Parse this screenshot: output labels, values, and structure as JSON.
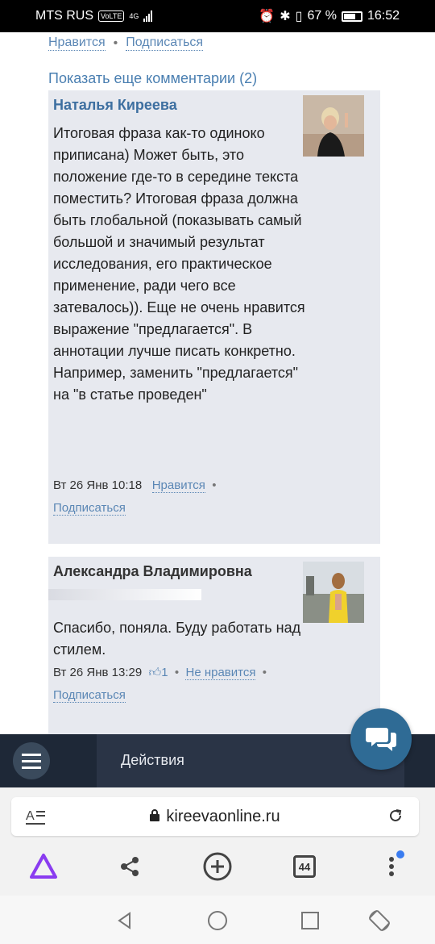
{
  "status": {
    "carrier": "MTS RUS",
    "volte": "VoLTE",
    "net": "4G",
    "battery": "67 %",
    "time": "16:52"
  },
  "prev_comment": {
    "like": "Нравится",
    "subscribe": "Подписаться"
  },
  "show_more": "Показать еще комментарии (2)",
  "comments": [
    {
      "author": "Наталья Киреева",
      "text": "Итоговая фраза как-то одиноко приписана) Может быть, это положение где-то в середине текста поместить? Итоговая фраза должна быть глобальной (показывать самый большой и значимый результат исследования, его практическое применение, ради чего все затевалось)). Еще не очень нравится выражение \"предлагается\". В аннотации лучше писать конкретно. Например, заменить \"предлагается\" на \"в статье проведен\"",
      "date": "Вт 26 Янв 10:18",
      "like": "Нравится",
      "subscribe": "Подписаться"
    },
    {
      "author": "Александра Владимировна",
      "text": "Спасибо, поняла. Буду работать над стилем.",
      "date": "Вт 26 Янв 13:29",
      "likes": "1",
      "dislike": "Не нравится",
      "subscribe": "Подписаться"
    }
  ],
  "action_bar": {
    "actions_label": "Действия"
  },
  "browser": {
    "url": "kireevaonline.ru",
    "tabs_count": "44"
  },
  "colors": {
    "link": "#5b87b5",
    "action_bar": "#1e2837",
    "fab": "#2f6b95"
  }
}
